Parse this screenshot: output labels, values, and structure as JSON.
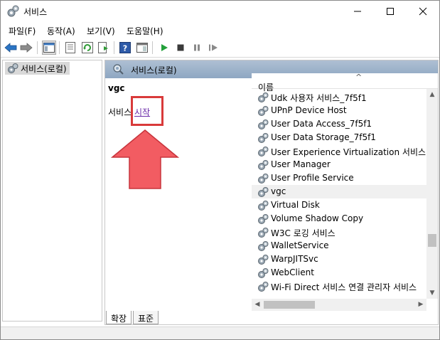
{
  "window": {
    "title": "서비스"
  },
  "menu": [
    "파일(F)",
    "동작(A)",
    "보기(V)",
    "도움말(H)"
  ],
  "toolbar": {
    "icons": [
      "back-arrow-icon",
      "forward-arrow-icon",
      "console-tree-icon",
      "properties-icon",
      "refresh-icon",
      "export-list-icon",
      "help-icon",
      "show-hide-icon",
      "play-icon",
      "stop-icon",
      "pause-icon",
      "restart-icon"
    ]
  },
  "tree": {
    "root_label": "서비스(로컬)"
  },
  "main": {
    "header_title": "서비스(로컬)",
    "selected_service": "vgc",
    "action_prefix": "서비스",
    "action_link": "시작"
  },
  "list": {
    "column_name": "이름",
    "selected_index": 7,
    "rows": [
      "Udk 사용자 서비스_7f5f1",
      "UPnP Device Host",
      "User Data Access_7f5f1",
      "User Data Storage_7f5f1",
      "User Experience Virtualization 서비스",
      "User Manager",
      "User Profile Service",
      "vgc",
      "Virtual Disk",
      "Volume Shadow Copy",
      "W3C 로깅 서비스",
      "WalletService",
      "WarpJITSvc",
      "WebClient",
      "Wi-Fi Direct 서비스 연결 관리자 서비스"
    ]
  },
  "tabs": [
    {
      "label": "확장",
      "active": true
    },
    {
      "label": "표준",
      "active": false
    }
  ],
  "colors": {
    "highlight": "#d93a3a",
    "arrow": "#f25c62",
    "header": "#9fb4cc",
    "link": "#6a2aa8"
  }
}
